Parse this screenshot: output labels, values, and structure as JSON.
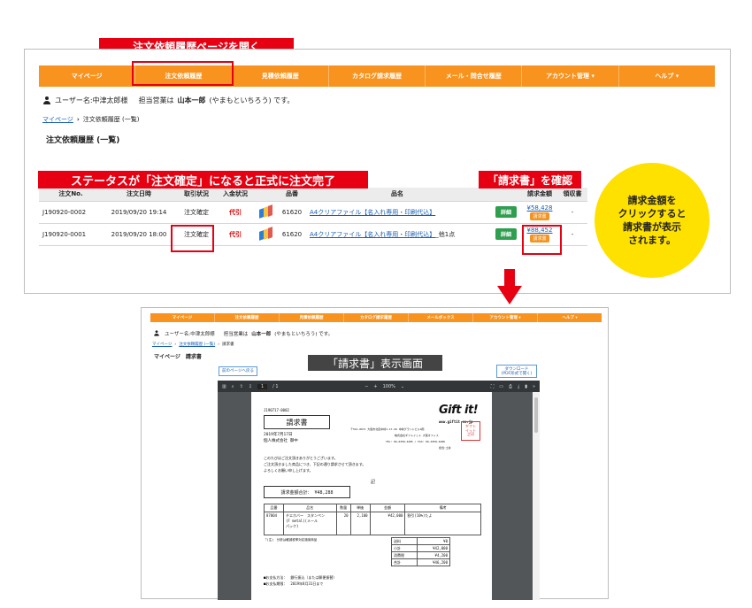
{
  "callouts": {
    "open_history": "注文依頼履歴ページを開く",
    "status_note": "ステータスが「注文確定」になると正式に注文完了",
    "check_invoice": "「請求書」を確認",
    "bubble": "請求金額を\nクリックすると\n請求書が表示\nされます。",
    "viewer_label": "「請求書」表示画面"
  },
  "colors": {
    "nav": "#f7931e",
    "accent_red": "#e60012",
    "bubble": "#ffe100",
    "link": "#1a5fb4",
    "detail_green": "#2f9e4f"
  },
  "top": {
    "nav": [
      "マイページ",
      "注文依頼履歴",
      "見積依頼履歴",
      "カタログ請求履歴",
      "メール・問合せ履歴",
      "アカウント管理 ▾",
      "ヘルプ ▾"
    ],
    "user": {
      "prefix": "ユーザー名:中津太郎様",
      "rep_label": "担当営業は",
      "rep_name": "山本一郎",
      "rep_suffix": "(やまもといちろう) です。"
    },
    "breadcrumb": {
      "home": "マイページ",
      "sep": "›",
      "current": "注文依頼履歴 (一覧)"
    },
    "heading": "注文依頼履歴 (一覧)",
    "table": {
      "headers": [
        "注文No.",
        "注文日時",
        "取引状況",
        "入金状況",
        "",
        "品番",
        "品名",
        "",
        "請求金額",
        "領収書"
      ],
      "rows": [
        {
          "no": "J190920-0002",
          "date": "2019/09/20 19:14",
          "status": "注文確定",
          "payment": "代引",
          "code": "61620",
          "name": "A4クリアファイル【名入れ専用・印刷代込】",
          "extra": "",
          "detail": "詳細",
          "amount": "¥58,428",
          "badge": "請求書",
          "receipt": "-"
        },
        {
          "no": "J190920-0001",
          "date": "2019/09/20 18:00",
          "status": "注文確定",
          "payment": "代引",
          "code": "61620",
          "name": "A4クリアファイル【名入れ専用・印刷代込】",
          "extra": "_他1点",
          "detail": "詳細",
          "amount": "¥88,452",
          "badge": "請求書",
          "receipt": "-"
        }
      ]
    }
  },
  "bottom": {
    "nav": [
      "マイページ",
      "注文依頼履歴",
      "見積依頼履歴",
      "カタログ請求履歴",
      "メールボックス",
      "アカウント管理 ▾",
      "ヘルプ ▾"
    ],
    "user": {
      "prefix": "ユーザー名:中津太郎様",
      "rep_label": "担当営業は",
      "rep_name": "山本一郎",
      "rep_suffix": "(やまもといちろう) です。"
    },
    "breadcrumb": {
      "home": "マイページ",
      "mid": "注文依頼履歴 (一覧)",
      "current": "請求書"
    },
    "heading": "マイページ　請求書",
    "back_button": "前のページへ戻る",
    "download_button": "ダウンロード\n(PDF形式で開く)",
    "pdf_toolbar": {
      "page": "1",
      "total": "/ 1",
      "zoom": "100%"
    },
    "invoice": {
      "number": "J190717-0002",
      "title": "請求書",
      "date": "2019年7月17日",
      "customer": "個人株式会社 御中",
      "logo": "Gift it!",
      "site": "www.giftit.co.jp",
      "address": "〒541-0071 大阪市北区中崎1-17-26 中崎グランドビル4階",
      "company": "株式会社ギフトイット 大阪オフィス",
      "tel": "TEL: 06-6358-4485 / FAX: 06-6358-4488",
      "rep": "担当:土井",
      "stamp": "ギフト\nイット\n之印",
      "msg1": "このたびはご注文頂きありがとうございます。",
      "msg2": "ご注文頂きました商品につき、下記の通り請求させて頂きます。",
      "msg3": "よろしくお願い申し上げます。",
      "ki": "記",
      "total_line": "請求金額合計： ¥48,288",
      "item_headers": [
        "品番",
        "品名",
        "数量",
        "単価",
        "金額",
        "備考"
      ],
      "item": {
        "code": "87004",
        "name": "チエホバー　スタンペン\n(F metal)(メール\nパック)",
        "qty": "20",
        "price": "2,100",
        "amount": "¥42,000",
        "note": "割引(10%)たよ"
      },
      "footnote": "「(注)　分析は軽減税率対応適用商品",
      "sums": [
        {
          "label": "送料",
          "value": "¥0"
        },
        {
          "label": "小計",
          "value": "¥42,000"
        },
        {
          "label": "消費税",
          "value": "¥4,200"
        },
        {
          "label": "合計",
          "value": "¥46,200"
        }
      ],
      "pay_method": "■お支払方法：　銀行振込（または郵便振替）",
      "pay_due": "■お支払期限：　2019年8月31日まで"
    }
  }
}
